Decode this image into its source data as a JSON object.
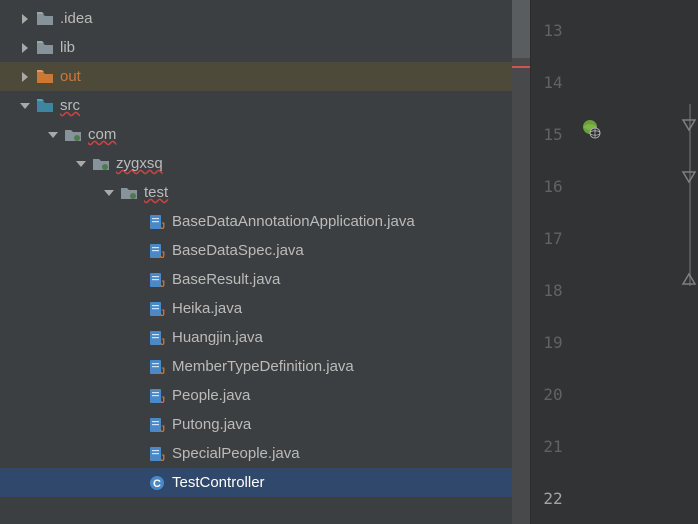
{
  "tree": {
    "items": [
      {
        "label": ".idea",
        "depth": 0,
        "iconType": "folder",
        "arrow": "right",
        "squiggle": false,
        "state": ""
      },
      {
        "label": "lib",
        "depth": 0,
        "iconType": "folder",
        "arrow": "right",
        "squiggle": false,
        "state": ""
      },
      {
        "label": "out",
        "depth": 0,
        "iconType": "folder-out",
        "arrow": "right",
        "squiggle": false,
        "state": "out"
      },
      {
        "label": "src",
        "depth": 0,
        "iconType": "folder-src",
        "arrow": "down",
        "squiggle": true,
        "state": ""
      },
      {
        "label": "com",
        "depth": 1,
        "iconType": "package",
        "arrow": "down",
        "squiggle": true,
        "state": ""
      },
      {
        "label": "zygxsq",
        "depth": 2,
        "iconType": "package",
        "arrow": "down",
        "squiggle": true,
        "state": ""
      },
      {
        "label": "test",
        "depth": 3,
        "iconType": "package",
        "arrow": "down",
        "squiggle": true,
        "state": ""
      },
      {
        "label": "BaseDataAnnotationApplication.java",
        "depth": 4,
        "iconType": "java",
        "arrow": "none",
        "squiggle": false,
        "state": ""
      },
      {
        "label": "BaseDataSpec.java",
        "depth": 4,
        "iconType": "java",
        "arrow": "none",
        "squiggle": false,
        "state": ""
      },
      {
        "label": "BaseResult.java",
        "depth": 4,
        "iconType": "java",
        "arrow": "none",
        "squiggle": false,
        "state": ""
      },
      {
        "label": "Heika.java",
        "depth": 4,
        "iconType": "java",
        "arrow": "none",
        "squiggle": false,
        "state": ""
      },
      {
        "label": "Huangjin.java",
        "depth": 4,
        "iconType": "java",
        "arrow": "none",
        "squiggle": false,
        "state": ""
      },
      {
        "label": "MemberTypeDefinition.java",
        "depth": 4,
        "iconType": "java",
        "arrow": "none",
        "squiggle": false,
        "state": ""
      },
      {
        "label": "People.java",
        "depth": 4,
        "iconType": "java",
        "arrow": "none",
        "squiggle": false,
        "state": ""
      },
      {
        "label": "Putong.java",
        "depth": 4,
        "iconType": "java",
        "arrow": "none",
        "squiggle": false,
        "state": ""
      },
      {
        "label": "SpecialPeople.java",
        "depth": 4,
        "iconType": "java",
        "arrow": "none",
        "squiggle": false,
        "state": ""
      },
      {
        "label": "TestController",
        "depth": 4,
        "iconType": "class",
        "arrow": "none",
        "squiggle": false,
        "state": "selected"
      }
    ]
  },
  "gutter": {
    "lines": [
      "13",
      "14",
      "15",
      "16",
      "17",
      "18",
      "19",
      "20",
      "21",
      "22"
    ],
    "currentLine": "22",
    "iconName": "globe-run-icon"
  },
  "colors": {
    "bg": "#3c3f41",
    "selected": "#2f486b",
    "outRow": "#4e4a3a",
    "text": "#bbbbbb",
    "orange": "#cc7832"
  }
}
